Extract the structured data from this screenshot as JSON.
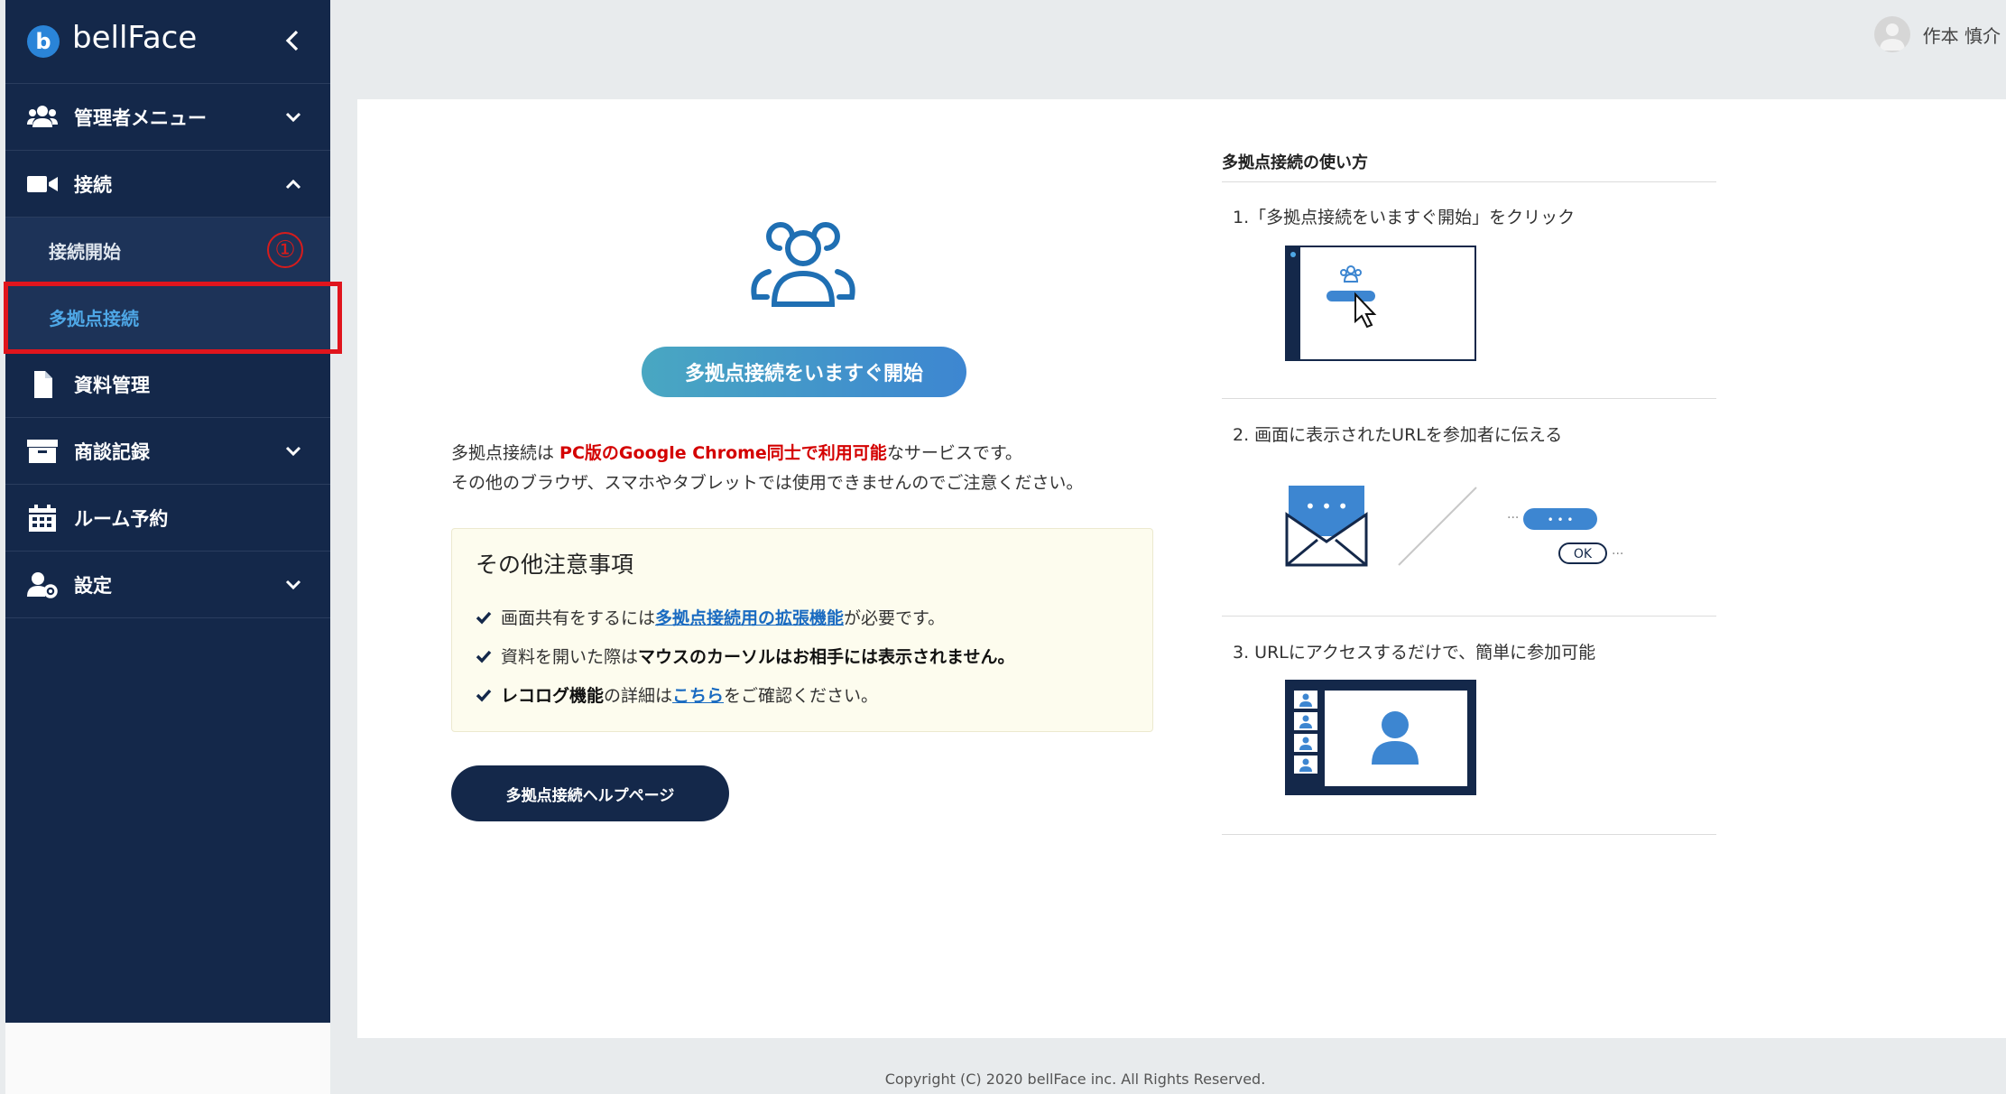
{
  "sidebar": {
    "brand": "bellFace",
    "items": [
      {
        "label": "管理者メニュー",
        "icon": "users-icon",
        "chevron": "down"
      },
      {
        "label": "接続",
        "icon": "video-camera-icon",
        "chevron": "up"
      },
      {
        "label": "資料管理",
        "icon": "document-icon"
      },
      {
        "label": "商談記録",
        "icon": "archive-box-icon",
        "chevron": "down"
      },
      {
        "label": "ルーム予約",
        "icon": "calendar-icon"
      },
      {
        "label": "設定",
        "icon": "user-gear-icon",
        "chevron": "down"
      }
    ],
    "sub_items": [
      {
        "label": "接続開始",
        "marker": "①"
      },
      {
        "label": "多拠点接続",
        "active": true
      }
    ]
  },
  "header": {
    "user_name": "作本 慎介"
  },
  "main": {
    "start_button": "多拠点接続をいますぐ開始",
    "notice_prefix": "多拠点接続は ",
    "notice_highlight": "PC版のGoogle Chrome同士で利用可能",
    "notice_suffix": "なサービスです。",
    "notice_line2": "その他のブラウザ、スマホやタブレットでは使用できませんのでご注意ください。",
    "notes_title": "その他注意事項",
    "note1_prefix": "画面共有をするには",
    "note1_link": "多拠点接続用の拡張機能",
    "note1_suffix": "が必要です。",
    "note2_prefix": "資料を開いた際は",
    "note2_bold": "マウスのカーソルはお相手には表示されません。",
    "note3_bold": "レコログ機能",
    "note3_mid": "の詳細は",
    "note3_link": "こちら",
    "note3_suffix": "をご確認ください。",
    "help_button": "多拠点接続ヘルプページ"
  },
  "guide": {
    "title": "多拠点接続の使い方",
    "steps": [
      {
        "text": "1.「多拠点接続をいますぐ開始」をクリック"
      },
      {
        "text": "2. 画面に表示されたURLを参加者に伝える"
      },
      {
        "text": "3. URLにアクセスするだけで、簡単に参加可能"
      }
    ],
    "dots_label": "• • •",
    "ok_label": "OK",
    "ellipsis": "···"
  },
  "footer": {
    "copyright": "Copyright (C) 2020 bellFace inc. All Rights Reserved."
  },
  "colors": {
    "sidebar_bg": "#14284a",
    "accent_blue": "#3d86d1",
    "highlight_red": "#e0151d",
    "warning_red": "#d40000"
  }
}
